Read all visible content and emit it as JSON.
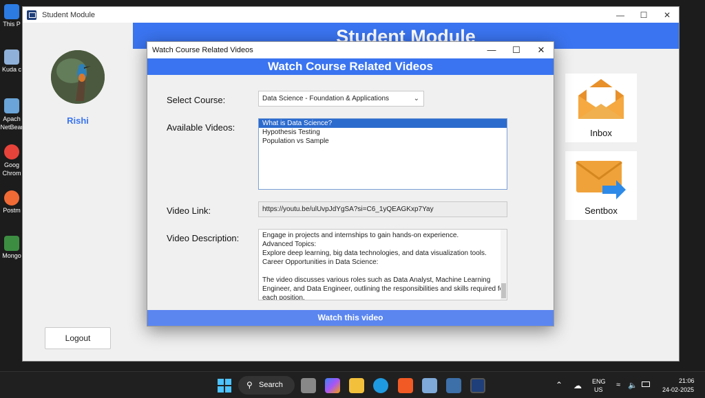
{
  "desktop": {
    "icons": [
      {
        "label": "This P",
        "color": "#2b7be3"
      },
      {
        "label": "Kuda c",
        "color": "#8fb0d8"
      },
      {
        "label": "Apach NetBear",
        "color": "#6aa4d8"
      },
      {
        "label": "Goog Chrom",
        "color": "#e8433a"
      },
      {
        "label": "Postm",
        "color": "#f06a35"
      },
      {
        "label": "Mongo",
        "color": "#3c8d42"
      }
    ]
  },
  "main_window": {
    "title": "Student Module",
    "header": "Student Module",
    "controls": {
      "minimize": "—",
      "maximize": "☐",
      "close": "✕"
    },
    "user": {
      "name": "Rishi"
    },
    "logout_label": "Logout",
    "tiles": {
      "inbox": "Inbox",
      "sentbox": "Sentbox"
    },
    "colors": {
      "accent": "#3a74f0",
      "mail": "#f0a23a",
      "arrow": "#2d8ae8"
    }
  },
  "dialog": {
    "title": "Watch Course Related Videos",
    "header": "Watch Course Related Videos",
    "controls": {
      "minimize": "—",
      "maximize": "☐",
      "close": "✕"
    },
    "labels": {
      "course": "Select Course:",
      "videos": "Available Videos:",
      "link": "Video Link:",
      "description": "Video Description:"
    },
    "course": {
      "selected": "Data Science - Foundation & Applications"
    },
    "videos": [
      {
        "title": "What is Data Science?",
        "selected": true
      },
      {
        "title": "Hypothesis Testing",
        "selected": false
      },
      {
        "title": "Population vs Sample",
        "selected": false
      }
    ],
    "video_link": "https://youtu.be/ulUvpJdYgSA?si=C6_1yQEAGKxp7Yay",
    "description_lines": [
      "Engage in projects and internships to gain hands-on experience.",
      "Advanced Topics:",
      "Explore deep learning, big data technologies, and data visualization tools.",
      "Career Opportunities in Data Science:",
      "",
      "The video discusses various roles such as Data Analyst, Machine Learning",
      "Engineer, and Data Engineer, outlining the responsibilities and skills required for",
      "each position."
    ],
    "watch_button": "Watch this video"
  },
  "taskbar": {
    "search_label": "Search",
    "language": "ENG",
    "region": "US",
    "time": "21:06",
    "date": "24-02-2025"
  }
}
